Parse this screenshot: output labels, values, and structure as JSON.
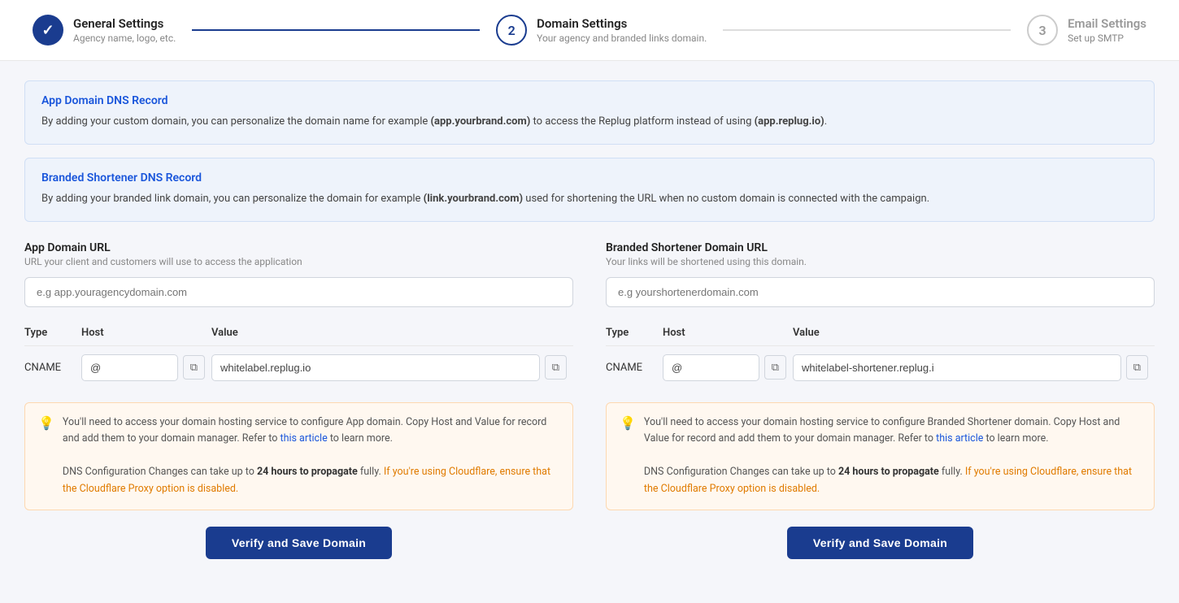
{
  "stepper": {
    "steps": [
      {
        "id": "general-settings",
        "number": "✓",
        "title": "General Settings",
        "subtitle": "Agency name, logo, etc.",
        "state": "done"
      },
      {
        "id": "domain-settings",
        "number": "2",
        "title": "Domain Settings",
        "subtitle": "Your agency and branded links domain.",
        "state": "active"
      },
      {
        "id": "email-settings",
        "number": "3",
        "title": "Email Settings",
        "subtitle": "Set up SMTP",
        "state": "inactive"
      }
    ]
  },
  "info_boxes": {
    "app_domain": {
      "title": "App Domain DNS Record",
      "text_before": "By adding your custom domain, you can personalize the domain name for example ",
      "highlight1": "(app.yourbrand.com)",
      "text_middle": " to access the Replug platform instead of using ",
      "highlight2": "(app.replug.io)",
      "text_after": "."
    },
    "branded_shortener": {
      "title": "Branded Shortener DNS Record",
      "text_before": "By adding your branded link domain, you can personalize the domain for example ",
      "highlight1": "(link.yourbrand.com)",
      "text_middle": " used for shortening the URL when no custom domain is connected with the campaign.",
      "text_after": ""
    }
  },
  "app_domain": {
    "label": "App Domain URL",
    "sublabel": "URL your client and customers will use to access the application",
    "placeholder": "e.g app.youragencydomain.com",
    "dns": {
      "type_header": "Type",
      "host_header": "Host",
      "value_header": "Value",
      "record_type": "CNAME",
      "host_value": "@",
      "cname_value": "whitelabel.replug.io"
    },
    "warning": {
      "text1": "You'll need to access your domain hosting service to configure App domain. Copy Host and Value for record and add them to your domain manager. Refer to ",
      "link_text": "this article",
      "text2": " to learn more.",
      "text3": "DNS Configuration Changes can take up to ",
      "bold1": "24 hours to propagate",
      "text4": " fully. ",
      "orange1": "If you're using Cloudflare, ensure that the Cloudflare Proxy option is disabled."
    },
    "button_label": "Verify and Save Domain"
  },
  "branded_shortener": {
    "label": "Branded Shortener Domain URL",
    "sublabel": "Your links will be shortened using this domain.",
    "placeholder": "e.g yourshortenerdomain.com",
    "dns": {
      "type_header": "Type",
      "host_header": "Host",
      "value_header": "Value",
      "record_type": "CNAME",
      "host_value": "@",
      "cname_value": "whitelabel-shortener.replug.i"
    },
    "warning": {
      "text1": "You'll need to access your domain hosting service to configure Branded Shortener domain. Copy Host and Value for record and add them to your domain manager. Refer to ",
      "link_text": "this article",
      "text2": " to learn more.",
      "text3": "DNS Configuration Changes can take up to ",
      "bold1": "24 hours to propagate",
      "text4": " fully. ",
      "orange1": "If you're using Cloudflare, ensure that the Cloudflare Proxy option is disabled."
    },
    "button_label": "Verify and Save Domain"
  },
  "icons": {
    "copy": "⧉",
    "warning": "💡",
    "checkmark": "✓"
  }
}
